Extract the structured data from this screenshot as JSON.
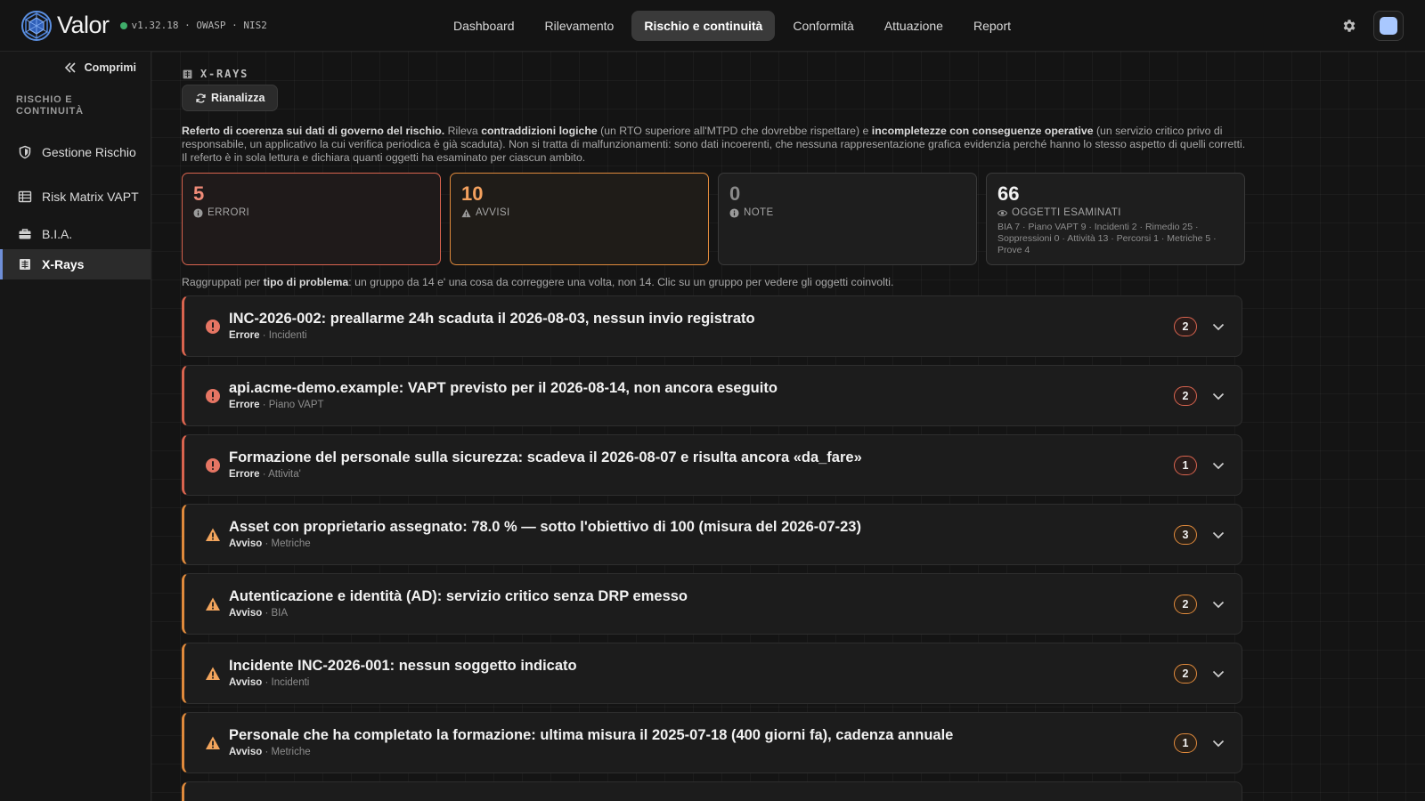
{
  "app": {
    "name": "Valor",
    "version": "v1.32.18 · OWASP · NIS2",
    "status_color": "#3fae6a"
  },
  "nav": {
    "items": [
      {
        "label": "Dashboard",
        "active": false
      },
      {
        "label": "Rilevamento",
        "active": false
      },
      {
        "label": "Rischio e continuità",
        "active": true
      },
      {
        "label": "Conformità",
        "active": false
      },
      {
        "label": "Attuazione",
        "active": false
      },
      {
        "label": "Report",
        "active": false
      }
    ]
  },
  "sidebar": {
    "collapse_label": "Comprimi",
    "section": "RISCHIO E CONTINUITÀ",
    "items": [
      {
        "label": "Gestione Rischio",
        "icon": "shield-icon",
        "active": false
      },
      {
        "label": "Risk Matrix VAPT",
        "icon": "table-icon",
        "active": false
      },
      {
        "label": "B.I.A.",
        "icon": "briefcase-icon",
        "active": false
      },
      {
        "label": "X-Rays",
        "icon": "xray-icon",
        "active": true
      }
    ]
  },
  "page": {
    "title": "X-RAYS",
    "reanalyze_label": "Rianalizza",
    "description": {
      "b1": "Referto di coerenza sui dati di governo del rischio.",
      "t1": " Rileva ",
      "b2": "contraddizioni logiche",
      "t2": " (un RTO superiore all'MTPD che dovrebbe rispettare) e ",
      "b3": "incompletezze con conseguenze operative",
      "t3": " (un servizio critico privo di responsabile, un applicativo la cui verifica periodica è già scaduta). Non si tratta di malfunzionamenti: sono dati incoerenti, che nessuna rappresentazione grafica evidenzia perché hanno lo stesso aspetto di quelli corretti. Il referto è in sola lettura e dichiara quanti oggetti ha esaminato per ciascun ambito."
    },
    "group_hint": {
      "t1": "Raggruppati per ",
      "b1": "tipo di problema",
      "t2": ": un gruppo da 14 e' una cosa da correggere una volta, non 14. Clic su un gruppo per vedere gli oggetti coinvolti."
    }
  },
  "stats": {
    "errors": {
      "value": "5",
      "label": "ERRORI",
      "color": "#f08b78"
    },
    "warnings": {
      "value": "10",
      "label": "AVVISI",
      "color": "#f4a15e"
    },
    "notes": {
      "value": "0",
      "label": "NOTE"
    },
    "examined": {
      "value": "66",
      "label": "OGGETTI ESAMINATI",
      "detail": "BIA 7 · Piano VAPT 9 · Incidenti 2 · Rimedio 25 · Soppressioni 0 · Attività 13 · Percorsi 1 · Metriche 5 · Prove 4"
    }
  },
  "findings": [
    {
      "severity": "error",
      "title": "INC-2026-002: preallarme 24h scaduta il 2026-08-03, nessun invio registrato",
      "severity_label": "Errore",
      "area": " · Incidenti",
      "count": "2"
    },
    {
      "severity": "error",
      "title": "api.acme-demo.example: VAPT previsto per il 2026-08-14, non ancora eseguito",
      "severity_label": "Errore",
      "area": " · Piano VAPT",
      "count": "2"
    },
    {
      "severity": "error",
      "title": "Formazione del personale sulla sicurezza: scadeva il 2026-08-07 e risulta ancora «da_fare»",
      "severity_label": "Errore",
      "area": " · Attivita'",
      "count": "1"
    },
    {
      "severity": "warning",
      "title": "Asset con proprietario assegnato: 78.0 % — sotto l'obiettivo di 100 (misura del 2026-07-23)",
      "severity_label": "Avviso",
      "area": " · Metriche",
      "count": "3"
    },
    {
      "severity": "warning",
      "title": "Autenticazione e identità (AD): servizio critico senza DRP emesso",
      "severity_label": "Avviso",
      "area": " · BIA",
      "count": "2"
    },
    {
      "severity": "warning",
      "title": "Incidente INC-2026-001: nessun soggetto indicato",
      "severity_label": "Avviso",
      "area": " · Incidenti",
      "count": "2"
    },
    {
      "severity": "warning",
      "title": "Personale che ha completato la formazione: ultima misura il 2025-07-18 (400 giorni fa), cadenza annuale",
      "severity_label": "Avviso",
      "area": " · Metriche",
      "count": "1"
    }
  ]
}
